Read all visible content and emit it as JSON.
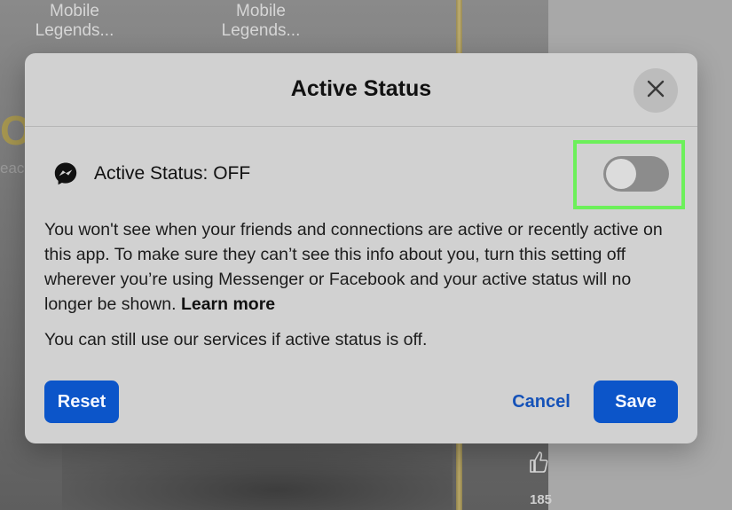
{
  "background": {
    "stories": [
      {
        "line1": "Mobile",
        "line2": "Legends..."
      },
      {
        "line1": "Mobile",
        "line2": "Legends..."
      }
    ],
    "fragment_big": "O",
    "fragment_small": "eac",
    "like_count": "185"
  },
  "modal": {
    "title": "Active Status",
    "close_icon": "close-icon",
    "status_icon": "messenger-icon",
    "status_label": "Active Status: OFF",
    "toggle_on": false,
    "description": "You won't see when your friends and connections are active or recently active on this app. To make sure they can’t see this info about you, turn this setting off wherever you’re using Messenger or Facebook and your active status will no longer be shown.",
    "learn_more": "Learn more",
    "note": "You can still use our services if active status is off.",
    "buttons": {
      "reset": "Reset",
      "cancel": "Cancel",
      "save": "Save"
    }
  },
  "colors": {
    "primary": "#0c55c9",
    "highlight": "#6cf05a",
    "toggle_off": "#8c8c8c"
  }
}
